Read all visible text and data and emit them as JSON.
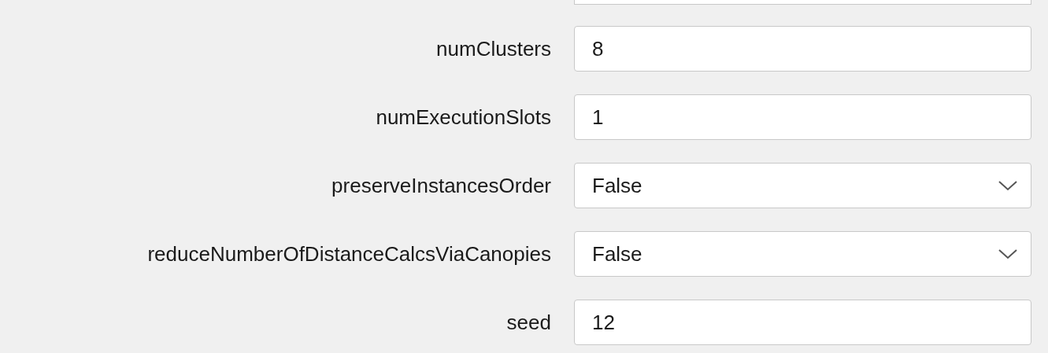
{
  "fields": [
    {
      "label": "numClusters",
      "kind": "text",
      "value": "8"
    },
    {
      "label": "numExecutionSlots",
      "kind": "text",
      "value": "1"
    },
    {
      "label": "preserveInstancesOrder",
      "kind": "dropdown",
      "value": "False"
    },
    {
      "label": "reduceNumberOfDistanceCalcsViaCanopies",
      "kind": "dropdown",
      "value": "False"
    },
    {
      "label": "seed",
      "kind": "text",
      "value": "12"
    }
  ]
}
